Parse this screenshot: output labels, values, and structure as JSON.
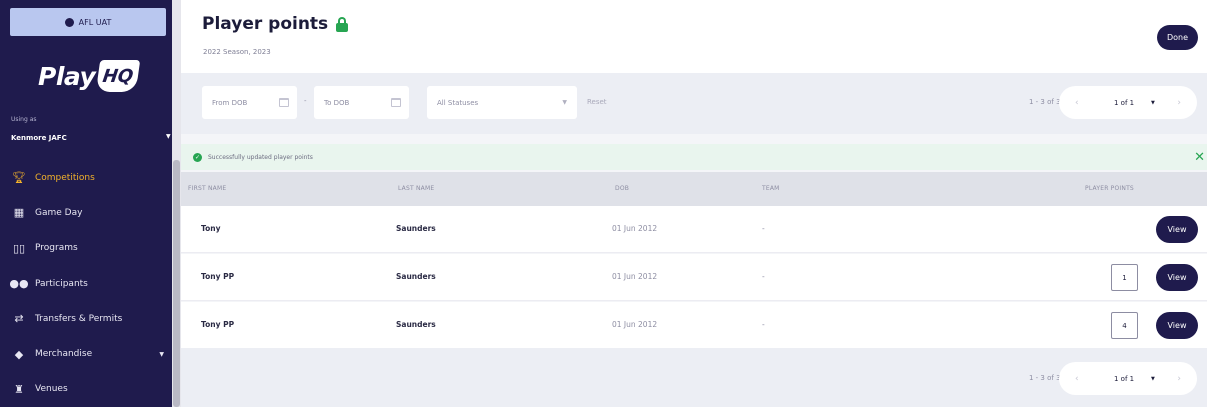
{
  "env": {
    "label": "AFL UAT"
  },
  "logo": {
    "play": "Play",
    "hq": "HQ"
  },
  "account": {
    "using_label": "Using as",
    "club": "Kenmore JAFC"
  },
  "nav": [
    {
      "label": "Competitions",
      "icon": "trophy-icon",
      "active": true
    },
    {
      "label": "Game Day",
      "icon": "scoreboard-icon"
    },
    {
      "label": "Programs",
      "icon": "book-icon"
    },
    {
      "label": "Participants",
      "icon": "people-icon"
    },
    {
      "label": "Transfers & Permits",
      "icon": "transfer-icon"
    },
    {
      "label": "Merchandise",
      "icon": "merchandise-icon",
      "has_caret": true
    },
    {
      "label": "Venues",
      "icon": "venue-icon"
    }
  ],
  "header": {
    "title": "Player points",
    "subtitle": "2022 Season, 2023",
    "done_label": "Done"
  },
  "filters": {
    "from_dob": "From DOB",
    "dash": "-",
    "to_dob": "To DOB",
    "status": "All Statuses",
    "reset": "Reset"
  },
  "pagination": {
    "count": "1 - 3 of 3",
    "page": "1 of 1",
    "count_bottom": "1 - 3 of 3",
    "page_bottom": "1 of 1"
  },
  "banner": {
    "message": "Successfully updated player points"
  },
  "table": {
    "columns": [
      "FIRST NAME",
      "LAST NAME",
      "DOB",
      "TEAM",
      "PLAYER POINTS"
    ],
    "rows": [
      {
        "first": "Tony",
        "last": "Saunders",
        "dob": "01 Jun 2012",
        "team": "-",
        "points": "",
        "view": "View"
      },
      {
        "first": "Tony PP",
        "last": "Saunders",
        "dob": "01 Jun 2012",
        "team": "-",
        "points": "1",
        "view": "View"
      },
      {
        "first": "Tony PP",
        "last": "Saunders",
        "dob": "01 Jun 2012",
        "team": "-",
        "points": "4",
        "view": "View"
      }
    ]
  },
  "colors": {
    "brand": "#1f1b4d",
    "accent": "#f3b22b",
    "success": "#27a552"
  }
}
